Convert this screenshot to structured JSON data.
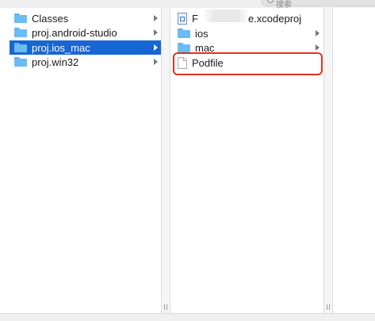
{
  "search": {
    "placeholder": "搜索"
  },
  "column1": {
    "items": [
      {
        "label": "Classes",
        "icon": "folder-icon",
        "selected": false
      },
      {
        "label": "proj.android-studio",
        "icon": "folder-icon",
        "selected": false
      },
      {
        "label": "proj.ios_mac",
        "icon": "folder-icon",
        "selected": true
      },
      {
        "label": "proj.win32",
        "icon": "folder-icon",
        "selected": false
      }
    ]
  },
  "column2": {
    "items": [
      {
        "label": "F",
        "label_tail": "e.xcodeproj",
        "icon": "xcodeproj-icon"
      },
      {
        "label": "ios",
        "icon": "folder-icon"
      },
      {
        "label": "mac",
        "icon": "folder-icon"
      },
      {
        "label": "Podfile",
        "icon": "document-icon"
      }
    ]
  },
  "colors": {
    "selection": "#1866d4",
    "folder": "#6bbcf4",
    "highlight_border": "#e0321e"
  }
}
